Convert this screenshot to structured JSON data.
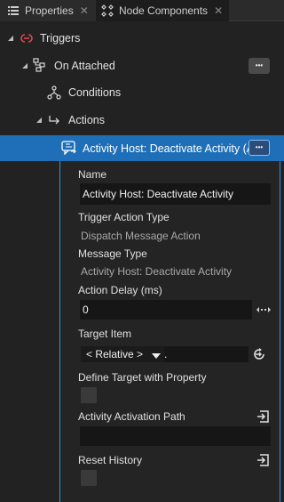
{
  "tabs": [
    {
      "label": "Properties",
      "icon": "list-icon",
      "active": false
    },
    {
      "label": "Node Components",
      "icon": "node-components-icon",
      "active": true
    }
  ],
  "tree": {
    "triggers_label": "Triggers",
    "on_attached_label": "On Attached",
    "conditions_label": "Conditions",
    "actions_label": "Actions",
    "selected_item_label": "Activity Host: Deactivate Activity (Ac",
    "more_label": "•••"
  },
  "properties": {
    "name_label": "Name",
    "name_value": "Activity Host: Deactivate Activity",
    "trigger_action_type_label": "Trigger Action Type",
    "trigger_action_type_value": "Dispatch Message Action",
    "message_type_label": "Message Type",
    "message_type_value": "Activity Host: Deactivate Activity",
    "action_delay_label": "Action Delay (ms)",
    "action_delay_value": "0",
    "target_item_label": "Target Item",
    "target_item_mode": "< Relative >",
    "target_item_value": ".",
    "define_target_label": "Define Target with Property",
    "define_target_checked": false,
    "activation_path_label": "Activity Activation Path",
    "activation_path_value": "",
    "reset_history_label": "Reset History",
    "reset_history_checked": false
  },
  "colors": {
    "selection": "#1e6fb7",
    "panel_border": "#3b8fd6",
    "trigger_icon": "#e0474c"
  }
}
